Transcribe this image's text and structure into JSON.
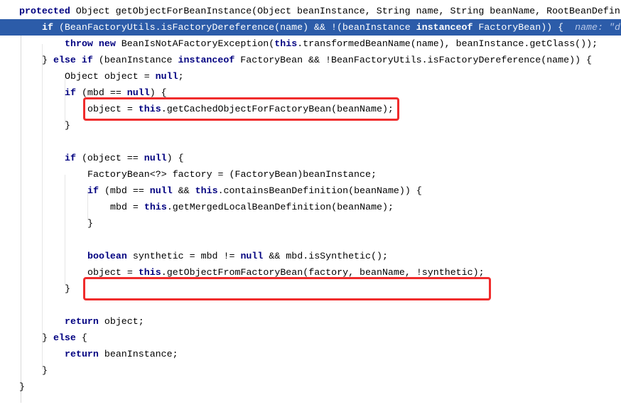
{
  "editor": {
    "highlight_color": "#2c5ca9",
    "annotation_color": "#f02c2c",
    "highlighted_line": 1,
    "boxed_lines": [
      5,
      16
    ],
    "lines": [
      {
        "indent": 0,
        "tokens": [
          [
            "kw",
            "protected"
          ],
          [
            "t",
            " Object getObjectForBeanInstance(Object beanInstance, String name, String beanName, RootBeanDefin"
          ]
        ]
      },
      {
        "indent": 1,
        "tokens": [
          [
            "kw",
            "if"
          ],
          [
            "t",
            " (BeanFactoryUtils.isFactoryDereference(name) && !(beanInstance "
          ],
          [
            "kw",
            "instanceof"
          ],
          [
            "t",
            " FactoryBean)) {  "
          ],
          [
            "hint",
            "name: \"d"
          ]
        ]
      },
      {
        "indent": 2,
        "tokens": [
          [
            "kw",
            "throw new"
          ],
          [
            "t",
            " BeanIsNotAFactoryException("
          ],
          [
            "kw",
            "this"
          ],
          [
            "t",
            ".transformedBeanName(name), beanInstance.getClass());"
          ]
        ]
      },
      {
        "indent": 1,
        "tokens": [
          [
            "t",
            "} "
          ],
          [
            "kw",
            "else if"
          ],
          [
            "t",
            " (beanInstance "
          ],
          [
            "kw",
            "instanceof"
          ],
          [
            "t",
            " FactoryBean && !BeanFactoryUtils.isFactoryDereference(name)) {"
          ]
        ]
      },
      {
        "indent": 2,
        "tokens": [
          [
            "t",
            "Object object = "
          ],
          [
            "kw",
            "null"
          ],
          [
            "t",
            ";"
          ]
        ]
      },
      {
        "indent": 2,
        "tokens": [
          [
            "kw",
            "if"
          ],
          [
            "t",
            " (mbd == "
          ],
          [
            "kw",
            "null"
          ],
          [
            "t",
            ") {"
          ]
        ]
      },
      {
        "indent": 3,
        "tokens": [
          [
            "t",
            "object = "
          ],
          [
            "kw",
            "this"
          ],
          [
            "t",
            ".getCachedObjectForFactoryBean(beanName);"
          ]
        ]
      },
      {
        "indent": 2,
        "tokens": [
          [
            "t",
            "}"
          ]
        ]
      },
      {
        "indent": 0,
        "tokens": []
      },
      {
        "indent": 2,
        "tokens": [
          [
            "kw",
            "if"
          ],
          [
            "t",
            " (object == "
          ],
          [
            "kw",
            "null"
          ],
          [
            "t",
            ") {"
          ]
        ]
      },
      {
        "indent": 3,
        "tokens": [
          [
            "t",
            "FactoryBean<?> factory = (FactoryBean)beanInstance;"
          ]
        ]
      },
      {
        "indent": 3,
        "tokens": [
          [
            "kw",
            "if"
          ],
          [
            "t",
            " (mbd == "
          ],
          [
            "kw",
            "null"
          ],
          [
            "t",
            " && "
          ],
          [
            "kw",
            "this"
          ],
          [
            "t",
            ".containsBeanDefinition(beanName)) {"
          ]
        ]
      },
      {
        "indent": 4,
        "tokens": [
          [
            "t",
            "mbd = "
          ],
          [
            "kw",
            "this"
          ],
          [
            "t",
            ".getMergedLocalBeanDefinition(beanName);"
          ]
        ]
      },
      {
        "indent": 3,
        "tokens": [
          [
            "t",
            "}"
          ]
        ]
      },
      {
        "indent": 0,
        "tokens": []
      },
      {
        "indent": 3,
        "tokens": [
          [
            "kw",
            "boolean"
          ],
          [
            "t",
            " synthetic = mbd != "
          ],
          [
            "kw",
            "null"
          ],
          [
            "t",
            " && mbd.isSynthetic();"
          ]
        ]
      },
      {
        "indent": 3,
        "tokens": [
          [
            "t",
            "object = "
          ],
          [
            "kw",
            "this"
          ],
          [
            "t",
            ".getObjectFromFactoryBean(factory, beanName, !synthetic);"
          ]
        ]
      },
      {
        "indent": 2,
        "tokens": [
          [
            "t",
            "}"
          ]
        ]
      },
      {
        "indent": 0,
        "tokens": []
      },
      {
        "indent": 2,
        "tokens": [
          [
            "kw",
            "return"
          ],
          [
            "t",
            " object;"
          ]
        ]
      },
      {
        "indent": 1,
        "tokens": [
          [
            "t",
            "} "
          ],
          [
            "kw",
            "else"
          ],
          [
            "t",
            " {"
          ]
        ]
      },
      {
        "indent": 2,
        "tokens": [
          [
            "kw",
            "return"
          ],
          [
            "t",
            " beanInstance;"
          ]
        ]
      },
      {
        "indent": 1,
        "tokens": [
          [
            "t",
            "}"
          ]
        ]
      },
      {
        "indent": 0,
        "tokens": [
          [
            "t",
            "}"
          ]
        ]
      }
    ]
  }
}
